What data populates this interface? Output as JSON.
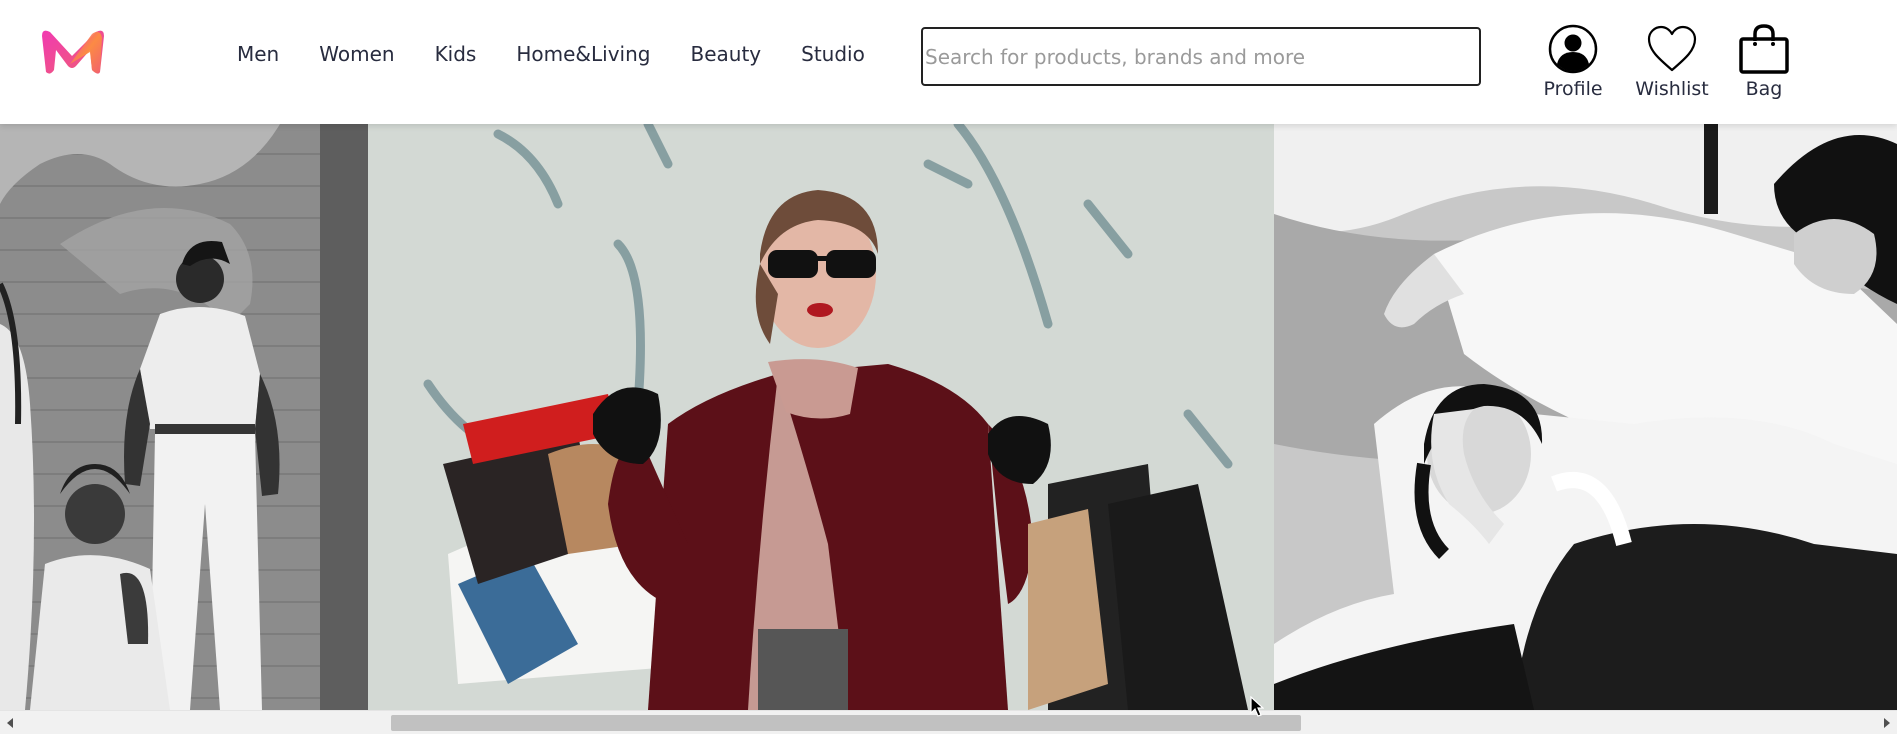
{
  "brand": {
    "logo_icon": "myntra-logo-icon",
    "colors": [
      "#f13ab1",
      "#fd913c",
      "#ee5f73"
    ]
  },
  "nav": {
    "items": [
      {
        "label": "Men"
      },
      {
        "label": "Women"
      },
      {
        "label": "Kids"
      },
      {
        "label": "Home&Living"
      },
      {
        "label": "Beauty"
      },
      {
        "label": "Studio"
      }
    ]
  },
  "search": {
    "value": "",
    "placeholder": "Search for products, brands and more"
  },
  "actions": {
    "profile": {
      "label": "Profile",
      "icon": "user-icon"
    },
    "wishlist": {
      "label": "Wishlist",
      "icon": "heart-icon"
    },
    "bag": {
      "label": "Bag",
      "icon": "shopping-bag-icon"
    }
  },
  "banner": {
    "slides": [
      {
        "icon": "photo-group-women-icon"
      },
      {
        "icon": "photo-woman-shopping-bags-icon"
      },
      {
        "icon": "photo-women-lying-icon"
      }
    ]
  },
  "scrollbar": {
    "position_fraction": 0.2,
    "visible_fraction": 0.49
  },
  "colors": {
    "text": "#282c3f",
    "scroll_track": "#f1f1f1",
    "scroll_thumb": "#c1c1c1"
  }
}
